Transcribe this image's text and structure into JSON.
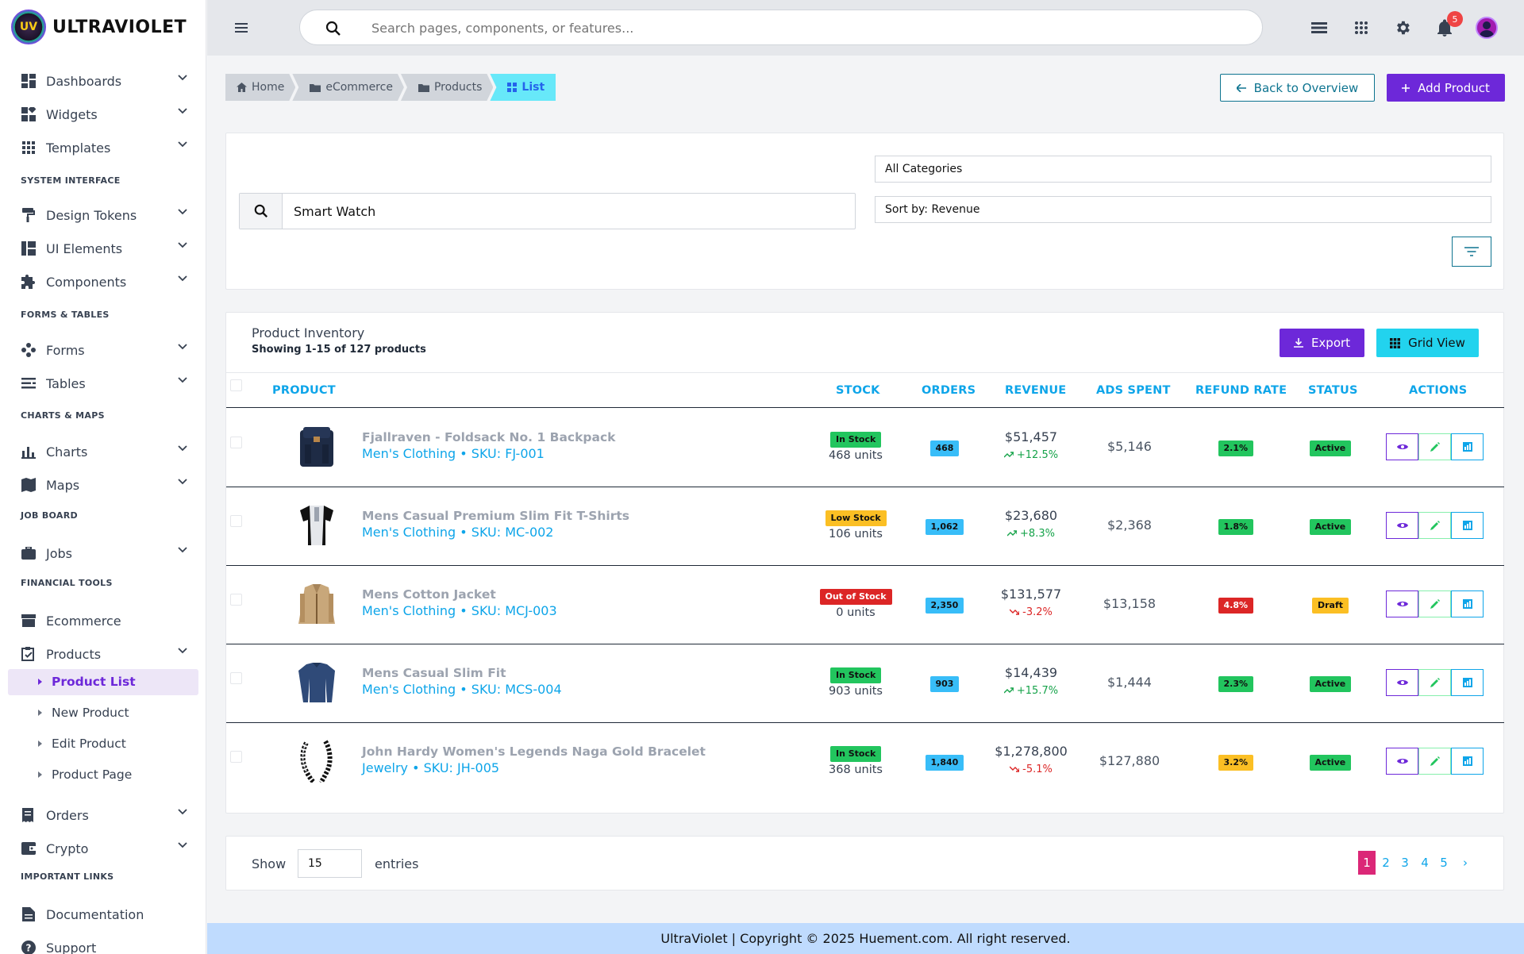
{
  "brand": {
    "name": "ULTRAVIOLET",
    "logo_text": "UV"
  },
  "sidebar": {
    "items": [
      {
        "label": "Dashboards",
        "icon": "dashboard-icon"
      },
      {
        "label": "Widgets",
        "icon": "widgets-icon"
      },
      {
        "label": "Templates",
        "icon": "apps-grid-icon"
      },
      {
        "label": "Design Tokens",
        "icon": "paint-roller-icon"
      },
      {
        "label": "UI Elements",
        "icon": "ui-elements-icon"
      },
      {
        "label": "Components",
        "icon": "puzzle-icon"
      },
      {
        "label": "Forms",
        "icon": "forms-icon"
      },
      {
        "label": "Tables",
        "icon": "tables-icon"
      },
      {
        "label": "Charts",
        "icon": "bar-chart-icon"
      },
      {
        "label": "Maps",
        "icon": "map-icon"
      },
      {
        "label": "Jobs",
        "icon": "briefcase-icon"
      },
      {
        "label": "Ecommerce",
        "icon": "store-icon"
      },
      {
        "label": "Products",
        "icon": "clipboard-icon"
      },
      {
        "label": "Orders",
        "icon": "receipt-icon"
      },
      {
        "label": "Crypto",
        "icon": "wallet-icon"
      },
      {
        "label": "Documentation",
        "icon": "document-icon"
      },
      {
        "label": "Support",
        "icon": "help-circle-icon"
      }
    ],
    "sections": [
      "SYSTEM INTERFACE",
      "FORMS & TABLES",
      "CHARTS & MAPS",
      "JOB BOARD",
      "FINANCIAL TOOLS",
      "IMPORTANT LINKS"
    ],
    "product_subitems": [
      "Product List",
      "New Product",
      "Edit Product",
      "Product Page"
    ]
  },
  "topbar": {
    "search_placeholder": "Search pages, components, or features...",
    "notification_count": "5"
  },
  "breadcrumb": [
    "Home",
    "eCommerce",
    "Products",
    "List"
  ],
  "actions": {
    "back": "Back to Overview",
    "add": "Add Product"
  },
  "filters": {
    "search_value": "Smart Watch",
    "category": "All Categories",
    "sort": "Sort by: Revenue"
  },
  "inventory": {
    "title": "Product Inventory",
    "subtitle": "Showing 1-15 of 127 products",
    "export_label": "Export",
    "grid_view_label": "Grid View",
    "columns": [
      "PRODUCT",
      "STOCK",
      "ORDERS",
      "REVENUE",
      "ADS SPENT",
      "REFUND RATE",
      "STATUS",
      "ACTIONS"
    ],
    "rows": [
      {
        "name": "Fjallraven - Foldsack No. 1 Backpack",
        "meta": "Men's Clothing • SKU: FJ-001",
        "stock": "In Stock",
        "stock_level": "green",
        "units": "468 units",
        "orders": "468",
        "revenue": "$51,457",
        "trend": "+12.5%",
        "trend_dir": "up",
        "ads": "$5,146",
        "refund": "2.1%",
        "refund_level": "green",
        "status": "Active",
        "status_level": "green",
        "thumb": "backpack"
      },
      {
        "name": "Mens Casual Premium Slim Fit T-Shirts",
        "meta": "Men's Clothing • SKU: MC-002",
        "stock": "Low Stock",
        "stock_level": "yellow",
        "units": "106 units",
        "orders": "1,062",
        "revenue": "$23,680",
        "trend": "+8.3%",
        "trend_dir": "up",
        "ads": "$2,368",
        "refund": "1.8%",
        "refund_level": "green",
        "status": "Active",
        "status_level": "green",
        "thumb": "tshirt"
      },
      {
        "name": "Mens Cotton Jacket",
        "meta": "Men's Clothing • SKU: MCJ-003",
        "stock": "Out of Stock",
        "stock_level": "red",
        "units": "0 units",
        "orders": "2,350",
        "revenue": "$131,577",
        "trend": "-3.2%",
        "trend_dir": "down",
        "ads": "$13,158",
        "refund": "4.8%",
        "refund_level": "red",
        "status": "Draft",
        "status_level": "yellow",
        "thumb": "jacket"
      },
      {
        "name": "Mens Casual Slim Fit",
        "meta": "Men's Clothing • SKU: MCS-004",
        "stock": "In Stock",
        "stock_level": "green",
        "units": "903 units",
        "orders": "903",
        "revenue": "$14,439",
        "trend": "+15.7%",
        "trend_dir": "up",
        "ads": "$1,444",
        "refund": "2.3%",
        "refund_level": "green",
        "status": "Active",
        "status_level": "green",
        "thumb": "longsleeve"
      },
      {
        "name": "John Hardy Women's Legends Naga Gold Bracelet",
        "meta": "Jewelry • SKU: JH-005",
        "stock": "In Stock",
        "stock_level": "green",
        "units": "368 units",
        "orders": "1,840",
        "revenue": "$1,278,800",
        "trend": "-5.1%",
        "trend_dir": "down",
        "ads": "$127,880",
        "refund": "3.2%",
        "refund_level": "yellow",
        "status": "Active",
        "status_level": "green",
        "thumb": "bracelet"
      }
    ]
  },
  "pagination": {
    "show_label": "Show",
    "entries_value": "15",
    "entries_label": "entries",
    "pages": [
      "1",
      "2",
      "3",
      "4",
      "5"
    ],
    "next": "›",
    "current": "1"
  },
  "footer": {
    "text": "UltraViolet | Copyright © 2025 Huement.com. All right reserved."
  },
  "colors": {
    "accent": "#6d28d9",
    "cyan": "#22d3ee",
    "link": "#0ea5e9",
    "active_page": "#db2777"
  }
}
